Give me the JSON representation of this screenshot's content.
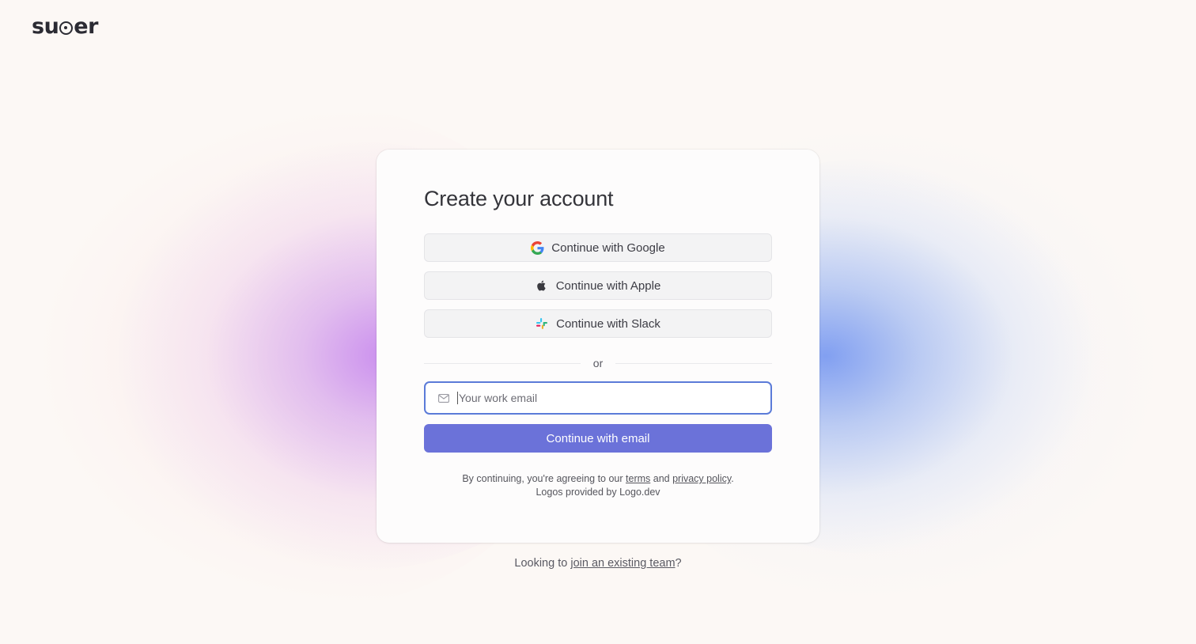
{
  "brand": {
    "logo_text_a": "su",
    "logo_text_b": "er",
    "logo_name": "super"
  },
  "card": {
    "title": "Create your account",
    "oauth": [
      {
        "label": "Continue with Google",
        "icon": "google-icon"
      },
      {
        "label": "Continue with Apple",
        "icon": "apple-icon"
      },
      {
        "label": "Continue with Slack",
        "icon": "slack-icon"
      }
    ],
    "divider_text": "or",
    "email": {
      "placeholder": "Your work email",
      "value": ""
    },
    "submit_label": "Continue with email",
    "legal": {
      "prefix": "By continuing, you're agreeing to our ",
      "terms": "terms",
      "and": " and ",
      "privacy": "privacy policy",
      "suffix": ".",
      "logos": "Logos provided by Logo.dev"
    }
  },
  "footer": {
    "prefix": "Looking to ",
    "link": "join an existing team",
    "suffix": "?"
  },
  "colors": {
    "primary": "#6b72d9",
    "input_focus": "#5b7bd8",
    "background": "#fcf8f5"
  }
}
